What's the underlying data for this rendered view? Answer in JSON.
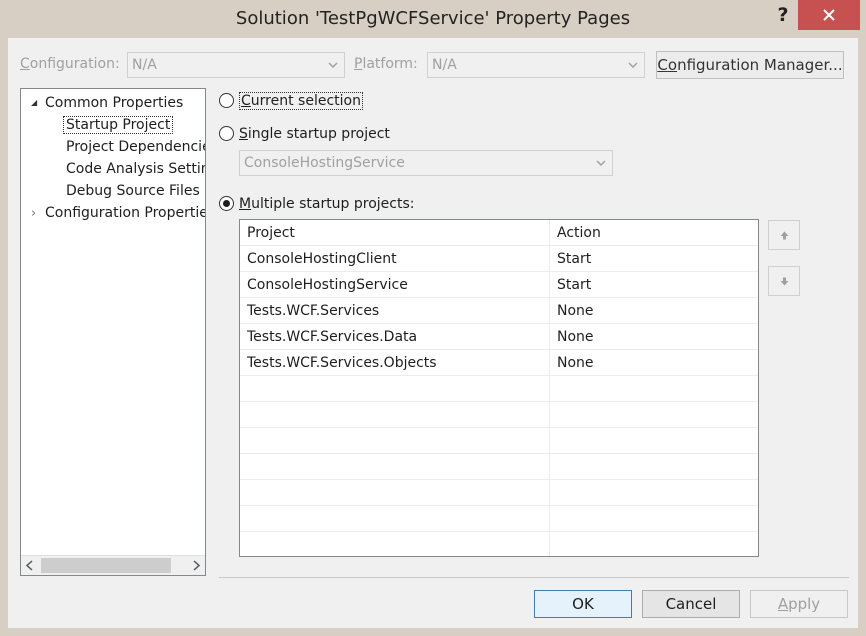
{
  "window": {
    "title": "Solution 'TestPgWCFService' Property Pages",
    "help_label": "?"
  },
  "toolbar": {
    "configuration_label_pre": "C",
    "configuration_label_rest": "onfiguration:",
    "configuration_value": "N/A",
    "platform_label_pre": "P",
    "platform_label_rest": "latform:",
    "platform_value": "N/A",
    "config_manager_pre": "C",
    "config_manager_mid": "o",
    "config_manager_rest": "nfiguration Manager..."
  },
  "tree": {
    "items": [
      {
        "label": "Common Properties",
        "expander": "▲"
      },
      {
        "label": "Startup Project"
      },
      {
        "label": "Project Dependencie"
      },
      {
        "label": "Code Analysis Setting"
      },
      {
        "label": "Debug Source Files"
      },
      {
        "label": "Configuration Properties",
        "expander": "›"
      }
    ]
  },
  "startup": {
    "current_selection_pre": "C",
    "current_selection_rest": "urrent selection",
    "single_pre": "S",
    "single_rest": "ingle startup project",
    "single_value": "ConsoleHostingService",
    "multiple_pre": "M",
    "multiple_rest": "ultiple startup projects:",
    "selected_option": "multiple"
  },
  "grid": {
    "headers": [
      "Project",
      "Action"
    ],
    "rows": [
      {
        "project": "ConsoleHostingClient",
        "action": "Start"
      },
      {
        "project": "ConsoleHostingService",
        "action": "Start"
      },
      {
        "project": "Tests.WCF.Services",
        "action": "None"
      },
      {
        "project": "Tests.WCF.Services.Data",
        "action": "None"
      },
      {
        "project": "Tests.WCF.Services.Objects",
        "action": "None"
      }
    ]
  },
  "buttons": {
    "ok": "OK",
    "cancel": "Cancel",
    "apply_pre": "A",
    "apply_rest": "pply"
  },
  "colors": {
    "close_button": "#c75050",
    "window_frame": "#d8cfc4",
    "client_background": "#f0f0f0"
  }
}
